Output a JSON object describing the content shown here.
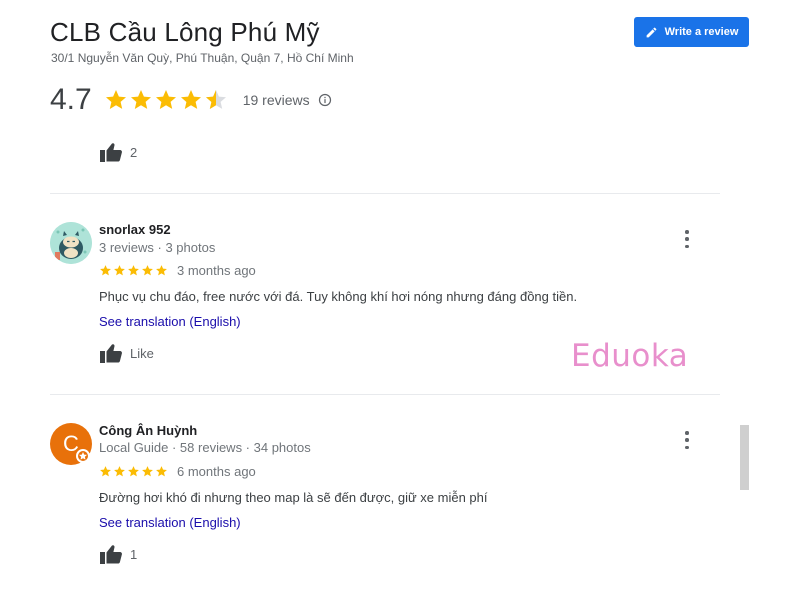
{
  "place": {
    "name": "CLB Cầu Lông Phú Mỹ",
    "address": "30/1 Nguyễn Văn Quỳ, Phú Thuận, Quận 7, Hồ Chí Minh",
    "rating": "4.7",
    "stars": 4.5,
    "reviews_count_label": "19 reviews"
  },
  "actions": {
    "write_review_label": "Write a review"
  },
  "top_like": {
    "count": "2"
  },
  "reviews": [
    {
      "name": "snorlax 952",
      "meta": "3 reviews · 3 photos",
      "stars": 5,
      "date": "3 months ago",
      "text": "Phục vụ chu đáo, free nước với đá. Tuy không khí hơi nóng nhưng đáng đồng tiền.",
      "translate_label": "See translation (English)",
      "like_label": "Like"
    },
    {
      "name": "Công Ân Huỳnh",
      "meta": "Local Guide · 58 reviews · 34 photos",
      "stars": 5,
      "date": "6 months ago",
      "text": "Đường hơi khó đi nhưng theo map là sẽ đến được, giữ xe miễn phí",
      "translate_label": "See translation (English)",
      "like_label": "1",
      "avatar_letter": "C"
    }
  ],
  "watermark": "Eduoka",
  "colors": {
    "star": "#fbbc04",
    "accent": "#1a73e8",
    "link": "#1a0dab",
    "avatar_orange": "#e8710a"
  }
}
